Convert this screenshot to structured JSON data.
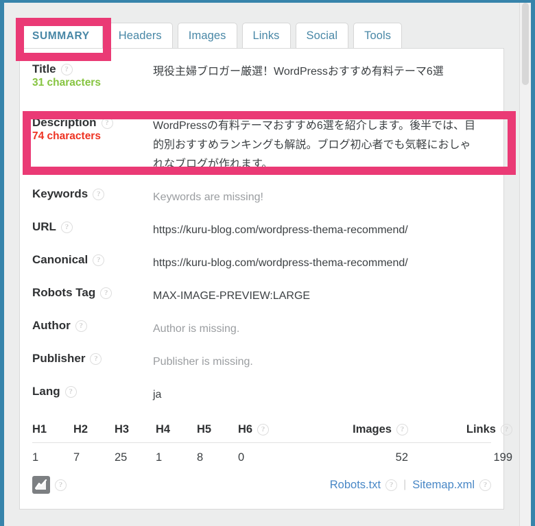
{
  "tabs": [
    {
      "id": "summary",
      "label": "SUMMARY",
      "active": true
    },
    {
      "id": "headers",
      "label": "Headers",
      "active": false
    },
    {
      "id": "images",
      "label": "Images",
      "active": false
    },
    {
      "id": "links",
      "label": "Links",
      "active": false
    },
    {
      "id": "social",
      "label": "Social",
      "active": false
    },
    {
      "id": "tools",
      "label": "Tools",
      "active": false
    }
  ],
  "help_glyph": "?",
  "rows": {
    "title": {
      "label": "Title",
      "value": "現役主婦ブロガー厳選！WordPressおすすめ有料テーマ6選",
      "char_count": "31 characters"
    },
    "description": {
      "label": "Description",
      "value": "WordPressの有料テーマおすすめ6選を紹介します。後半では、目的別おすすめランキングも解説。ブログ初心者でも気軽におしゃれなブログが作れます。",
      "char_count": "74 characters"
    },
    "keywords": {
      "label": "Keywords",
      "value": "Keywords are missing!"
    },
    "url": {
      "label": "URL",
      "value": "https://kuru-blog.com/wordpress-thema-recommend/"
    },
    "canonical": {
      "label": "Canonical",
      "value": "https://kuru-blog.com/wordpress-thema-recommend/"
    },
    "robots_tag": {
      "label": "Robots Tag",
      "value": "MAX-IMAGE-PREVIEW:LARGE"
    },
    "author": {
      "label": "Author",
      "value": "Author is missing."
    },
    "publisher": {
      "label": "Publisher",
      "value": "Publisher is missing."
    },
    "lang": {
      "label": "Lang",
      "value": "ja"
    }
  },
  "counts_table": {
    "headers": [
      "H1",
      "H2",
      "H3",
      "H4",
      "H5",
      "H6",
      "Images",
      "Links"
    ],
    "values": [
      "1",
      "7",
      "25",
      "1",
      "8",
      "0",
      "52",
      "199"
    ]
  },
  "footer": {
    "chart_icon": "chart-icon",
    "robots_link": "Robots.txt",
    "sitemap_link": "Sitemap.xml",
    "separator": "|"
  },
  "colors": {
    "annotation_pink": "#ea3a75",
    "browser_border_blue": "#3784ab",
    "tab_text_blue": "#4887a6",
    "link_blue": "#4887c6",
    "char_count_ok": "#86c440",
    "char_count_warn": "#ee3322"
  }
}
